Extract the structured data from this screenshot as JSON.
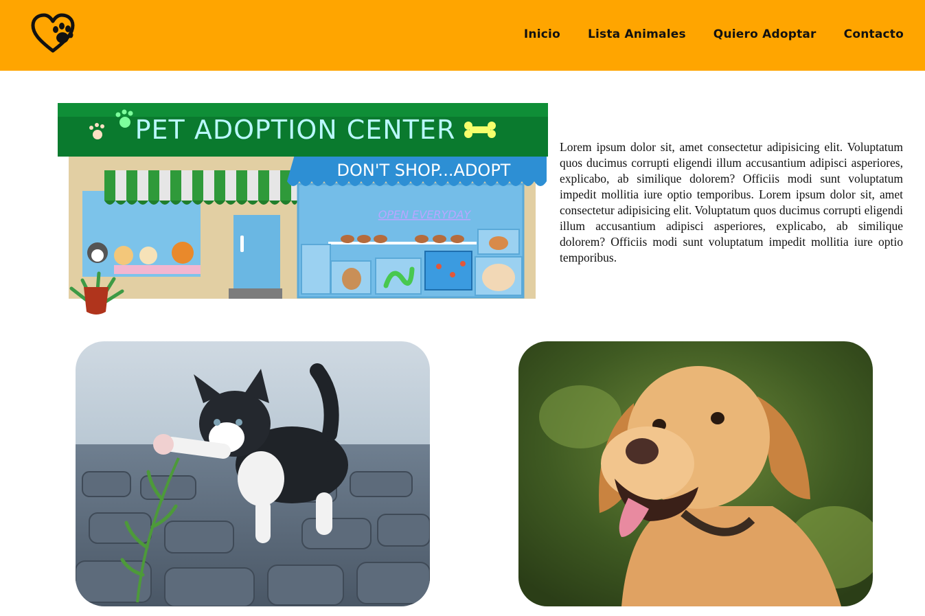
{
  "header": {
    "logo_icon": "heart-paw-icon",
    "nav": [
      "Inicio",
      "Lista Animales",
      "Quiero Adoptar",
      "Contacto"
    ]
  },
  "store_image": {
    "sign": "PET ADOPTION CENTER",
    "awning": "DON'T SHOP...ADOPT",
    "hours": "OPEN EVERYDAY"
  },
  "intro": {
    "text": "Lorem ipsum dolor sit, amet consectetur adipisicing elit. Voluptatum quos ducimus corrupti eligendi illum accusantium adipisci asperiores, explicabo, ab similique dolorem? Officiis modi sunt voluptatum impedit mollitia iure optio temporibus. Lorem ipsum dolor sit, amet consectetur adipisicing elit. Voluptatum quos ducimus corrupti eligendi illum accusantium adipisci asperiores, explicabo, ab similique dolorem? Officiis modi sunt voluptatum impedit mollitia iure optio temporibus."
  },
  "colors": {
    "header_bg": "#ffa500",
    "sign_green": "#0a7a2e",
    "awning_blue": "#2d8fd4"
  },
  "photos": [
    "kitten-photo",
    "labrador-photo"
  ]
}
